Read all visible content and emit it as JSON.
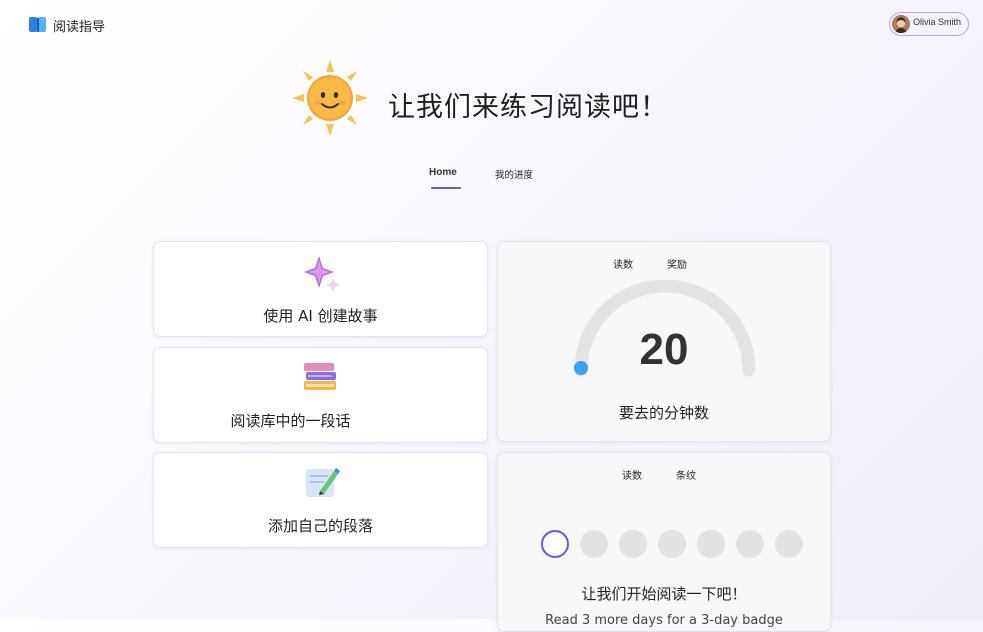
{
  "header": {
    "app_title": "阅读指导",
    "user_name": "Olivia Smith"
  },
  "hero": {
    "title": "让我们来练习阅读吧！"
  },
  "tabs": [
    {
      "label": "Home",
      "active": true
    },
    {
      "label": "我的进度",
      "active": false
    }
  ],
  "actions": [
    {
      "label": "使用 AI 创建故事",
      "icon": "sparkle-icon"
    },
    {
      "label": "阅读库中的一段话",
      "icon": "books-icon"
    },
    {
      "label": "添加自己的段落",
      "icon": "pencil-icon"
    }
  ],
  "gauge": {
    "segments": [
      "读数",
      "奖励"
    ],
    "value": "20",
    "progress": 0.0,
    "caption": "要去的分钟数"
  },
  "streak": {
    "segments": [
      "读数",
      "条纹"
    ],
    "days_total": 7,
    "days_completed": 0,
    "message": "让我们开始阅读一下吧！",
    "subtext": "Read 3 more days for a 3-day badge"
  },
  "colors": {
    "accent": "#6b5bd3",
    "gauge_track": "#e3e3e3",
    "gauge_fill": "#3aa0f0"
  }
}
